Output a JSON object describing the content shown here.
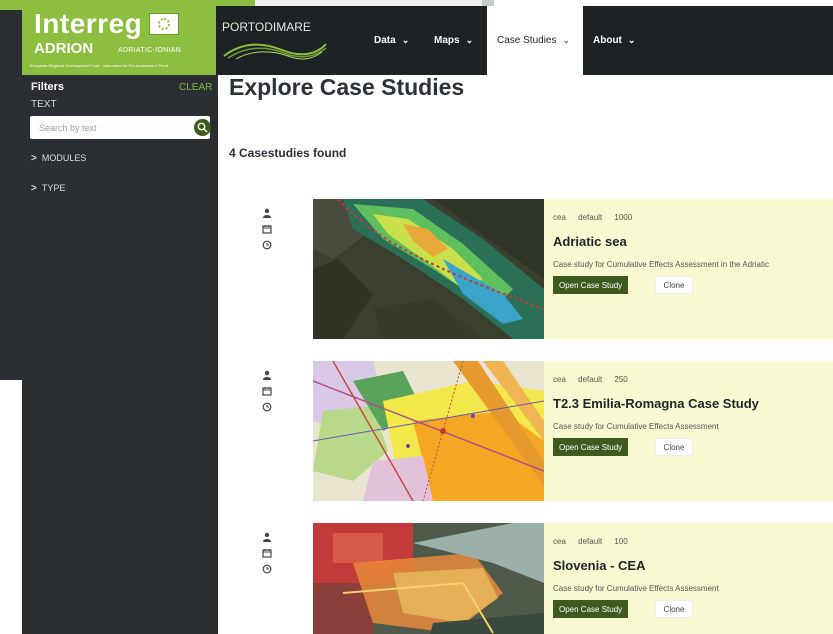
{
  "header": {
    "logo_main": "Interreg",
    "logo_region": "ADRION",
    "logo_subregion": "ADRIATIC-IONIAN",
    "logo_tagline": "European Regional Development Fund - Instrument for Pre-Accession II Fund",
    "project_title": "PORTODIMARE",
    "nav": [
      {
        "label": "Data",
        "icon": "chevron-down-icon"
      },
      {
        "label": "Maps",
        "icon": "chevron-down-icon"
      },
      {
        "label": "Case Studies",
        "icon": "chevron-down-icon",
        "active": true
      },
      {
        "label": "About",
        "icon": "chevron-down-icon"
      }
    ]
  },
  "sidebar": {
    "title": "Filters",
    "clear_label": "CLEAR",
    "text_label": "TEXT",
    "search_placeholder": "Search by text",
    "sections": [
      {
        "label": "MODULES"
      },
      {
        "label": "TYPE"
      }
    ]
  },
  "main": {
    "title": "Explore Case Studies",
    "count_text": "4 Casestudies found",
    "cards": [
      {
        "module": "cea",
        "scope": "default",
        "value": "1000",
        "title": "Adriatic sea",
        "description": "Case study for Cumulative Effects Assessment in the Adriatic",
        "open_label": "Open Case Study",
        "clone_label": "Clone"
      },
      {
        "module": "cea",
        "scope": "default",
        "value": "250",
        "title": "T2.3 Emilia-Romagna Case Study",
        "description": "Case study for Cumulative Effects Assessment",
        "open_label": "Open Case Study",
        "clone_label": "Clone"
      },
      {
        "module": "cea",
        "scope": "default",
        "value": "100",
        "title": "Slovenia - CEA",
        "description": "Case study for Cumulative Effects Assessment",
        "open_label": "Open Case Study",
        "clone_label": "Clone"
      }
    ]
  },
  "colors": {
    "brand_green": "#8cbf3f",
    "dark_green": "#3e5a1f",
    "header_bg": "#1d2225",
    "sidebar_bg": "#2b2f33",
    "card_info_bg": "#fafad2"
  }
}
